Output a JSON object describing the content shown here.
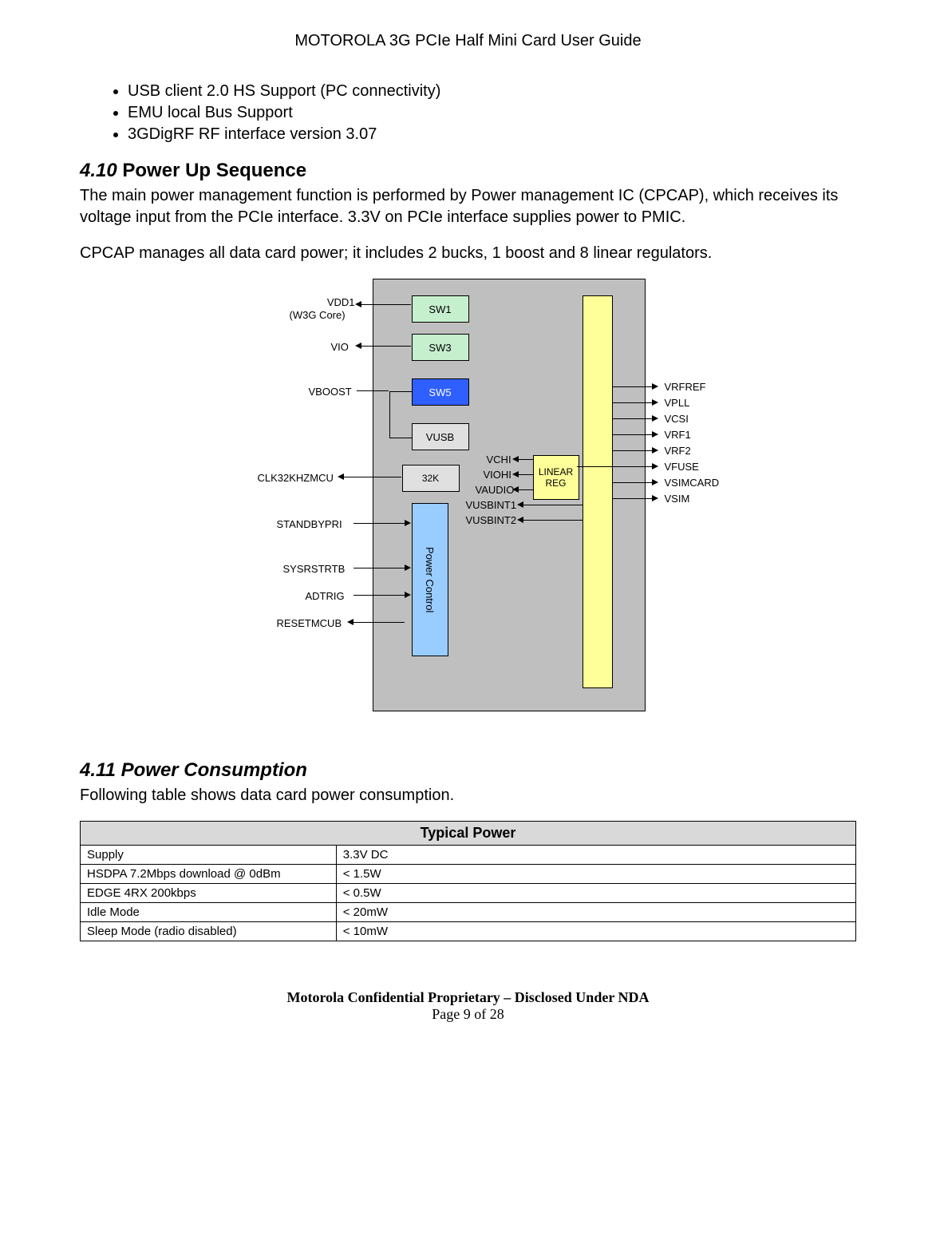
{
  "header": "MOTOROLA 3G PCIe Half Mini Card User Guide",
  "bullets": [
    "USB client 2.0 HS Support (PC connectivity)",
    "EMU local Bus Support",
    "3GDigRF RF interface version 3.07"
  ],
  "section_410": {
    "num": "4.10",
    "title": "Power Up Sequence"
  },
  "para_410a": "The main power management function is performed by Power management IC (CPCAP), which receives its voltage input from the PCIe interface. 3.3V  on PCIe interface supplies power to PMIC.",
  "para_410b": "CPCAP manages all data card power; it includes 2 bucks, 1 boost and 8 linear regulators.",
  "diagram": {
    "sw1": "SW1",
    "sw3": "SW3",
    "sw5": "SW5",
    "vusb": "VUSB",
    "k32": "32K",
    "power_control": "Power Control",
    "linear_reg": "LINEAR REG",
    "left": {
      "vdd1_a": "VDD1",
      "vdd1_b": "(W3G Core)",
      "vio": "VIO",
      "vboost": "VBOOST",
      "clk": "CLK32KHZMCU",
      "standby": "STANDBYPRI",
      "sysrst": "SYSRSTRTB",
      "adtrig": "ADTRIG",
      "reset": "RESETMCUB"
    },
    "mid": {
      "vchi": "VCHI",
      "viohi": "VIOHI",
      "vaudio": "VAUDIO",
      "vusbint1": "VUSBINT1",
      "vusbint2": "VUSBINT2"
    },
    "right": {
      "vrfref": "VRFREF",
      "vpll": "VPLL",
      "vcsi": "VCSI",
      "vrf1": "VRF1",
      "vrf2": "VRF2",
      "vfuse": "VFUSE",
      "vsimcard": "VSIMCARD",
      "vsim": "VSIM"
    }
  },
  "section_411": {
    "num": "4.11",
    "title": "Power Consumption"
  },
  "para_411": "Following table shows data card power consumption.",
  "table": {
    "header": "Typical Power",
    "rows": [
      {
        "label": "Supply",
        "value": "3.3V DC"
      },
      {
        "label": "HSDPA 7.2Mbps download @ 0dBm",
        "value": "< 1.5W"
      },
      {
        "label": "EDGE 4RX 200kbps",
        "value": "< 0.5W"
      },
      {
        "label": "Idle Mode",
        "value": "< 20mW"
      },
      {
        "label": "Sleep Mode (radio disabled)",
        "value": "< 10mW"
      }
    ]
  },
  "footer": {
    "line1": "Motorola Confidential Proprietary – Disclosed Under NDA",
    "line2": "Page 9 of 28"
  }
}
